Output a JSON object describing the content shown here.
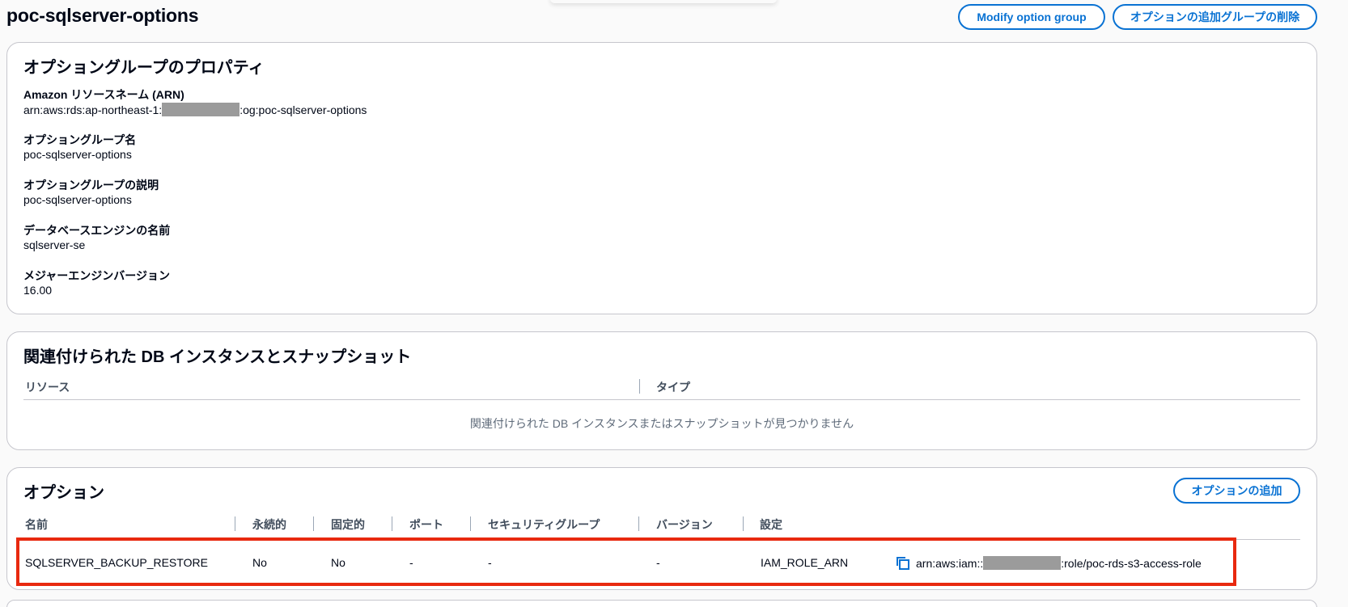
{
  "header": {
    "title": "poc-sqlserver-options",
    "modify_button": "Modify option group",
    "delete_button": "オプションの追加グループの削除"
  },
  "properties": {
    "title": "オプショングループのプロパティ",
    "arn_label": "Amazon リソースネーム (ARN)",
    "arn_prefix": "arn:aws:rds:ap-northeast-1:",
    "arn_suffix": ":og:poc-sqlserver-options",
    "name_label": "オプショングループ名",
    "name_value": "poc-sqlserver-options",
    "desc_label": "オプショングループの説明",
    "desc_value": "poc-sqlserver-options",
    "engine_label": "データベースエンジンの名前",
    "engine_value": "sqlserver-se",
    "version_label": "メジャーエンジンバージョン",
    "version_value": "16.00"
  },
  "associated": {
    "title": "関連付けられた DB インスタンスとスナップショット",
    "columns": [
      "リソース",
      "タイプ"
    ],
    "empty_message": "関連付けられた DB インスタンスまたはスナップショットが見つかりません"
  },
  "options": {
    "title": "オプション",
    "add_button": "オプションの追加",
    "columns": [
      "名前",
      "永続的",
      "固定的",
      "ポート",
      "セキュリティグループ",
      "バージョン",
      "設定"
    ],
    "rows": [
      {
        "name": "SQLSERVER_BACKUP_RESTORE",
        "persistent": "No",
        "permanent": "No",
        "port": "-",
        "security_group": "-",
        "version": "-",
        "setting_name": "IAM_ROLE_ARN",
        "setting_value_prefix": "arn:aws:iam::",
        "setting_value_suffix": ":role/poc-rds-s3-access-role"
      }
    ]
  },
  "colors": {
    "accent": "#0972d3",
    "highlight": "#e8290f",
    "redaction": "#9b9b9b"
  }
}
